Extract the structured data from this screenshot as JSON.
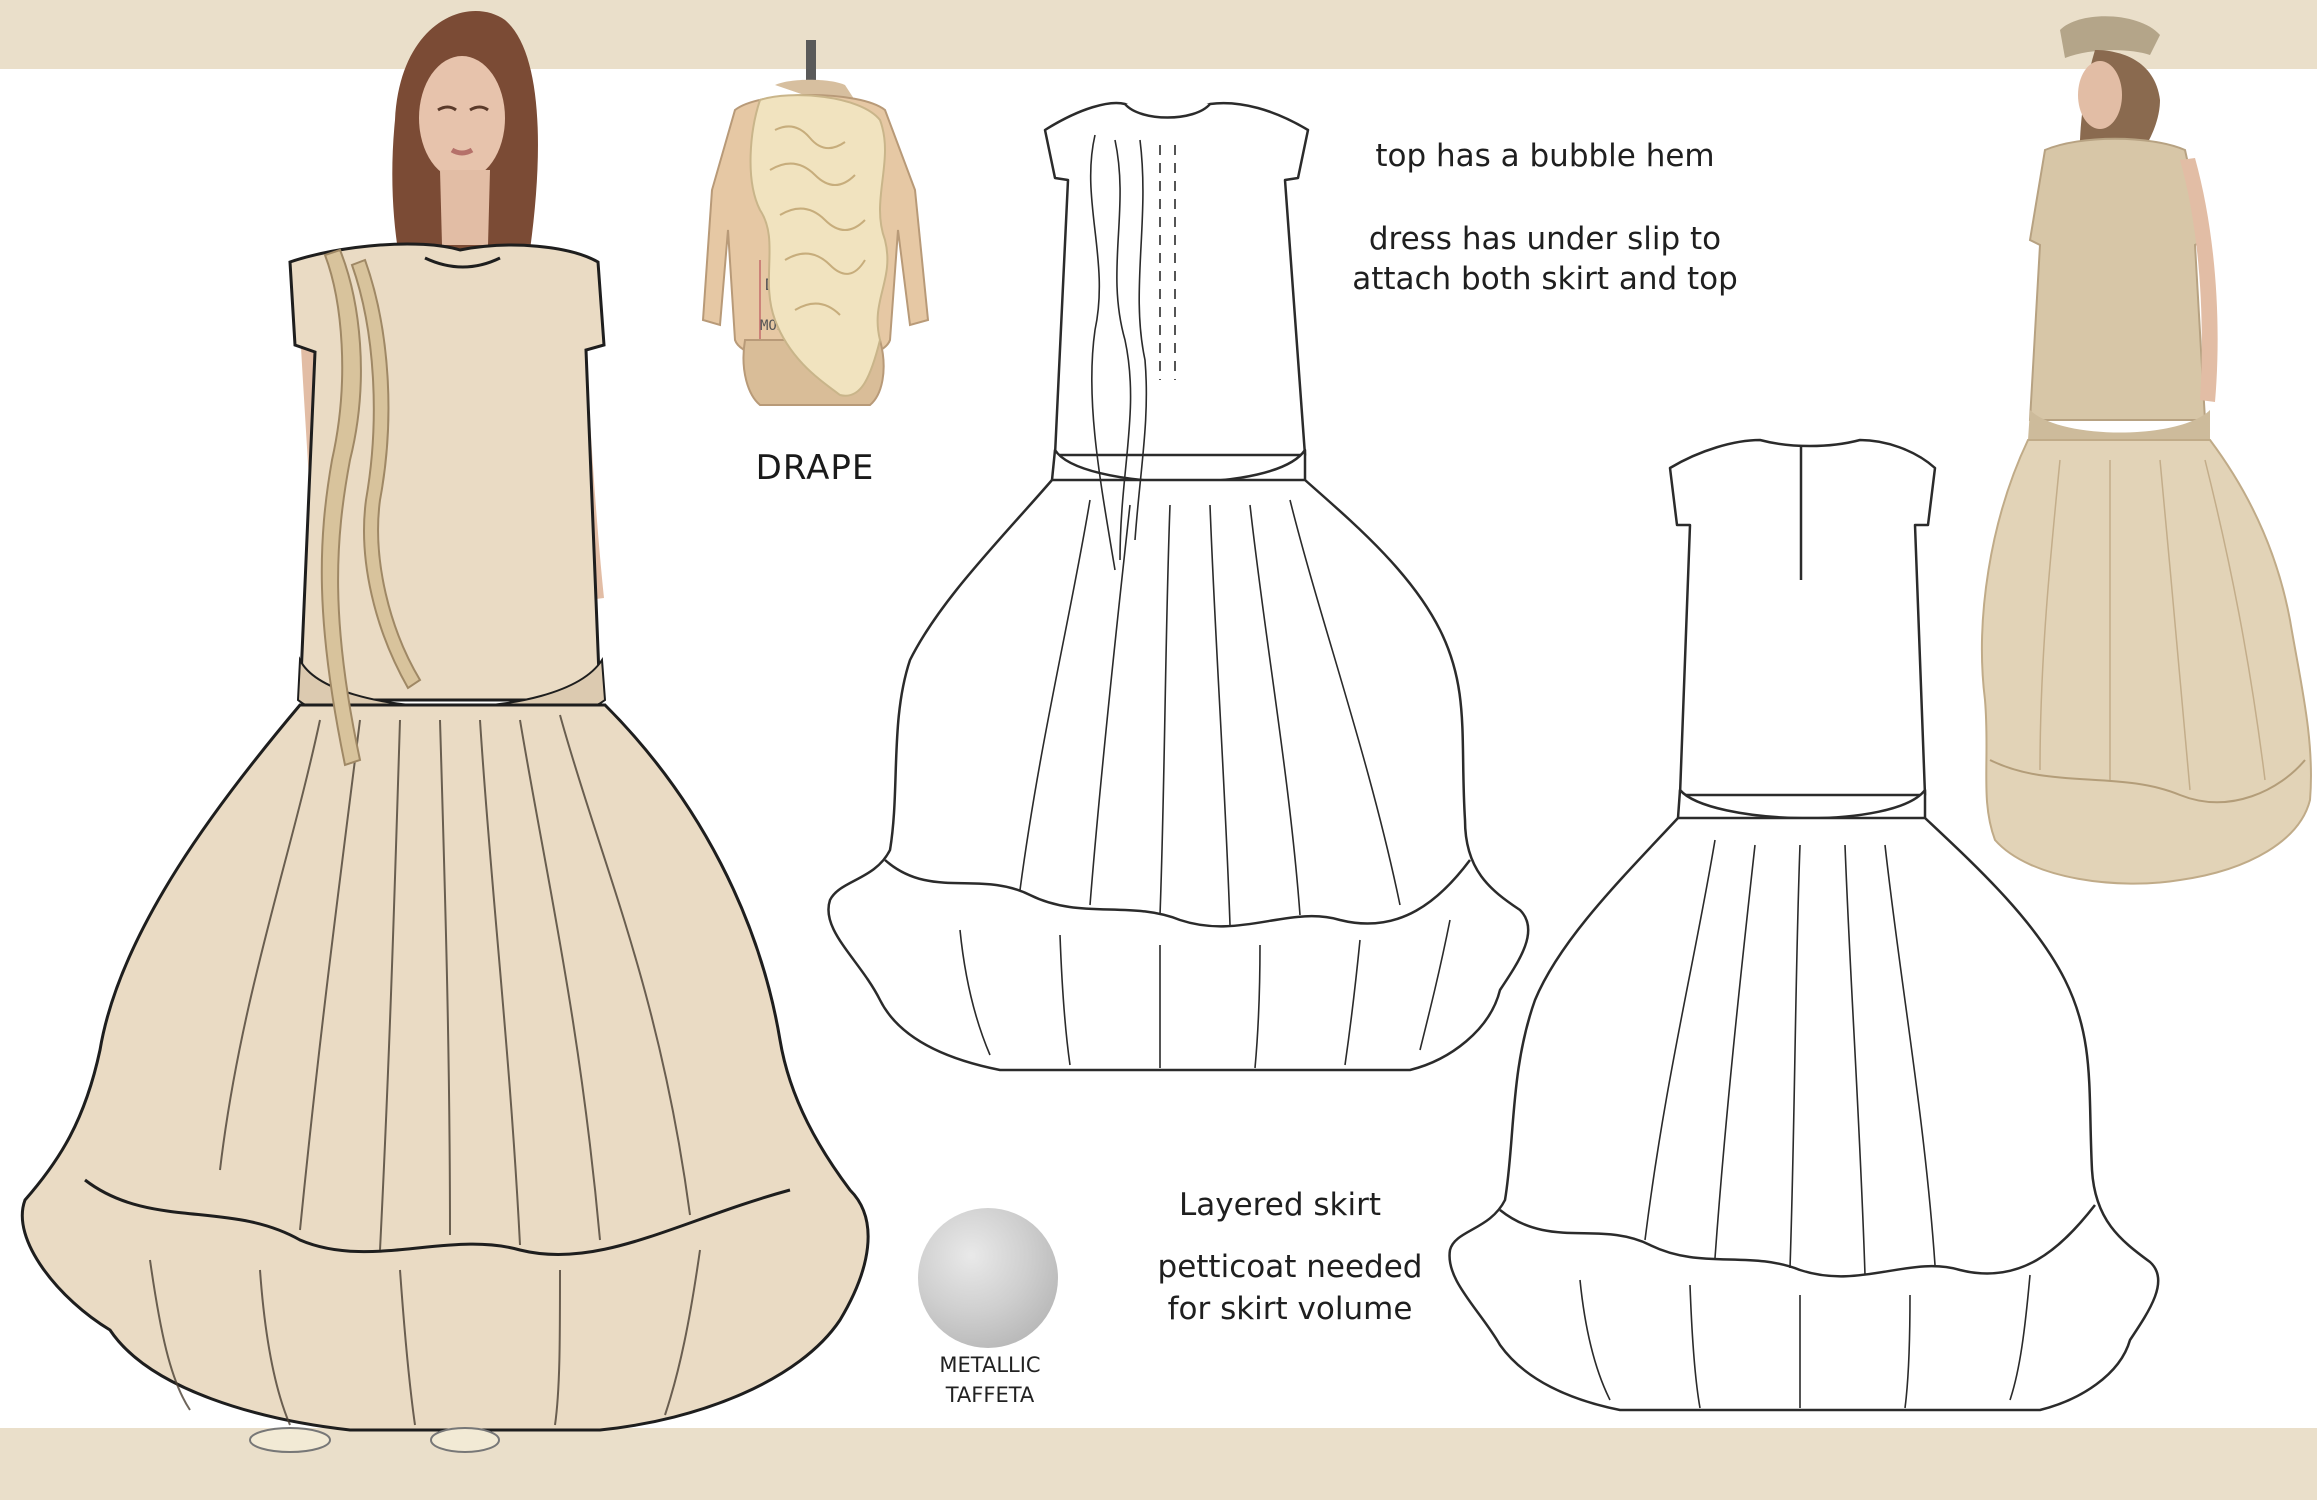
{
  "colors": {
    "frame_band": "#eadfca",
    "fabric": "#eadbc4",
    "fabric_shadow": "#d6c3a5",
    "flat_line": "#2b2b2b",
    "swatch": "#c8c8c8"
  },
  "drape": {
    "label": "DRAPE"
  },
  "notes": {
    "top_line1": "top has a bubble hem",
    "top_line2": "dress has under slip to",
    "top_line3": "attach both skirt and top",
    "bottom_line1": "Layered skirt",
    "bottom_line2": "petticoat needed",
    "bottom_line3": "for skirt volume"
  },
  "swatch": {
    "label": "METALLIC\nTAFFETA"
  },
  "icons": [
    "fashion-illustration",
    "dress-form-drape-photo",
    "flat-sketch-front",
    "flat-sketch-back",
    "model-photo",
    "fabric-swatch"
  ]
}
